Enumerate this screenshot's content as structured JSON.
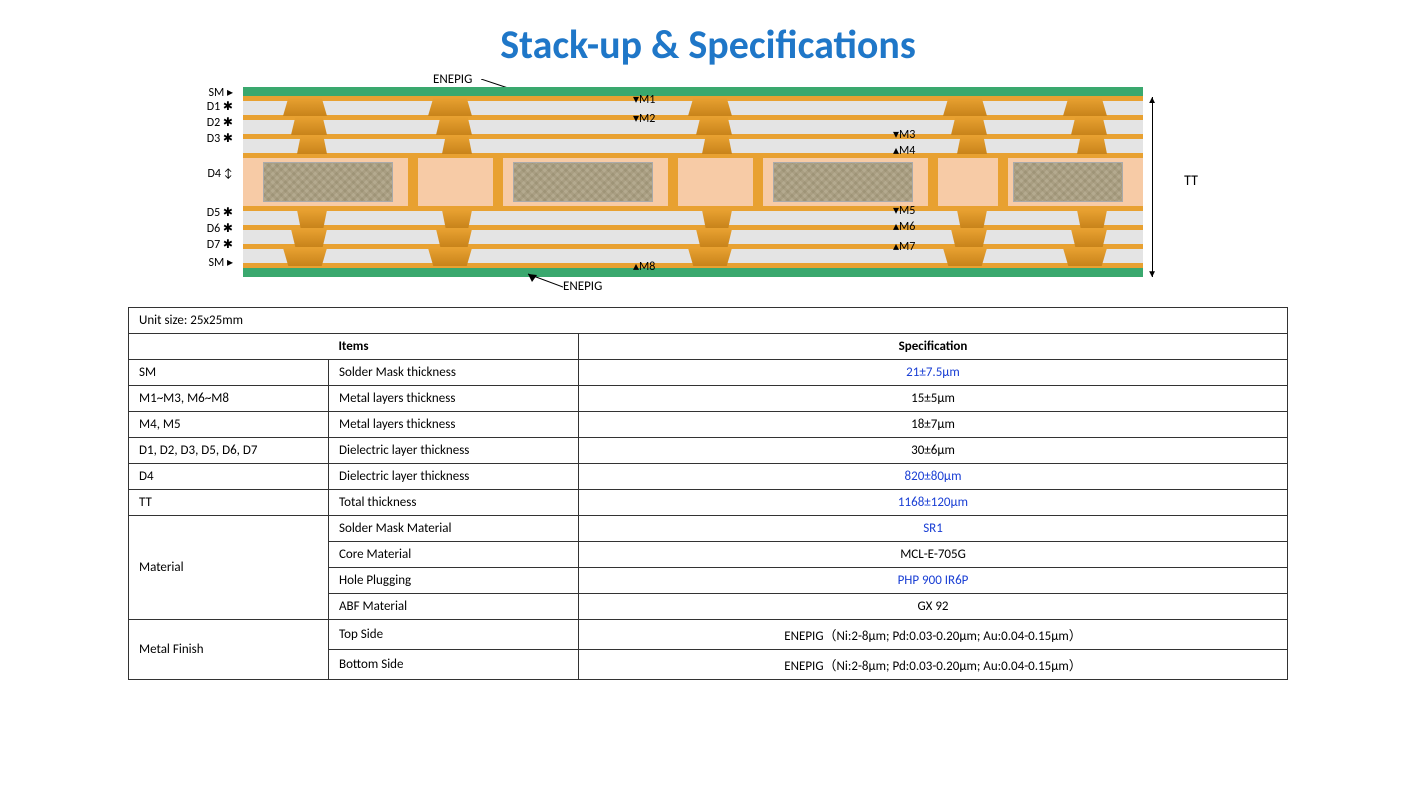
{
  "title": "Stack-up & Specifications",
  "diagram": {
    "enepig_top": "ENEPIG",
    "enepig_bot": "ENEPIG",
    "left_labels": {
      "sm_t": "SM",
      "d1": "D1",
      "d2": "D2",
      "d3": "D3",
      "d4": "D4",
      "d5": "D5",
      "d6": "D6",
      "d7": "D7",
      "sm_b": "SM"
    },
    "m_labels": {
      "m1": "M1",
      "m2": "M2",
      "m3": "M3",
      "m4": "M4",
      "m5": "M5",
      "m6": "M6",
      "m7": "M7",
      "m8": "M8"
    },
    "tt": "TT"
  },
  "table": {
    "unit_size": "Unit size: 25x25mm",
    "hdr_items": "Items",
    "hdr_spec": "Specification",
    "rows": {
      "sm": {
        "a": "SM",
        "b": "Solder Mask thickness",
        "c": "21±7.5μm"
      },
      "m_outer": {
        "a": "M1~M3, M6~M8",
        "b": "Metal layers thickness",
        "c": "15±5μm"
      },
      "m_inner": {
        "a": "M4, M5",
        "b": "Metal layers thickness",
        "c": "18±7μm"
      },
      "d_outer": {
        "a": "D1, D2, D3, D5, D6, D7",
        "b": "Dielectric layer thickness",
        "c": "30±6μm"
      },
      "d_core": {
        "a": "D4",
        "b": "Dielectric layer thickness",
        "c": "820±80μm"
      },
      "tt": {
        "a": "TT",
        "b": "Total thickness",
        "c": "1168±120μm"
      },
      "material": {
        "a": "Material",
        "sm": {
          "b": "Solder Mask  Material",
          "c": "SR1"
        },
        "core": {
          "b": "Core Material",
          "c": "MCL-E-705G"
        },
        "hole": {
          "b": "Hole Plugging",
          "c": "PHP 900 IR6P"
        },
        "abf": {
          "b": "ABF Material",
          "c": "GX 92"
        }
      },
      "finish": {
        "a": "Metal Finish",
        "top": {
          "b": "Top Side",
          "c": "ENEPIG（Ni:2-8μm; Pd:0.03-0.20μm; Au:0.04-0.15μm）"
        },
        "bot": {
          "b": "Bottom Side",
          "c": "ENEPIG（Ni:2-8μm; Pd:0.03-0.20μm; Au:0.04-0.15μm）"
        }
      }
    }
  }
}
